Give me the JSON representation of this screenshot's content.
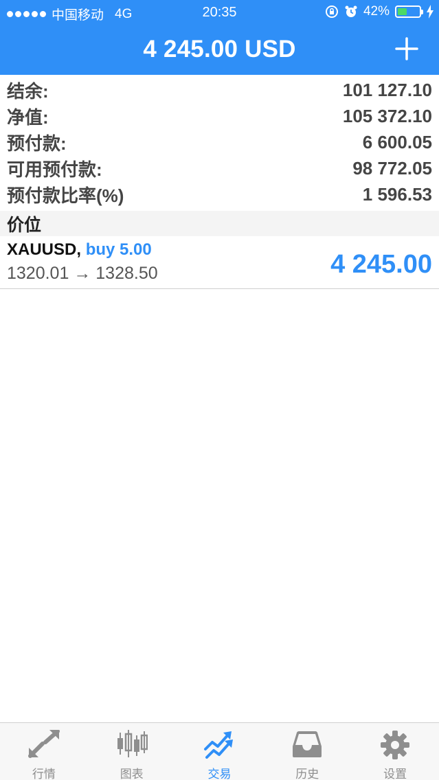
{
  "status_bar": {
    "carrier": "中国移动",
    "network": "4G",
    "time": "20:35",
    "battery_percent": "42%",
    "battery_level": 0.42
  },
  "header": {
    "title": "4 245.00 USD"
  },
  "summary": {
    "rows": [
      {
        "label": "结余:",
        "value": "101 127.10"
      },
      {
        "label": "净值:",
        "value": "105 372.10"
      },
      {
        "label": "预付款:",
        "value": "6 600.05"
      },
      {
        "label": "可用预付款:",
        "value": "98 772.05"
      },
      {
        "label": "预付款比率(%)",
        "value": "1 596.53"
      }
    ]
  },
  "section": {
    "title": "价位"
  },
  "position": {
    "symbol": "XAUUSD,",
    "direction": "buy 5.00",
    "prices": "1320.01 → 1328.50",
    "profit": "4 245.00"
  },
  "tabs": [
    {
      "label": "行情",
      "icon": "quotes-icon",
      "active": false
    },
    {
      "label": "图表",
      "icon": "chart-icon",
      "active": false
    },
    {
      "label": "交易",
      "icon": "trade-icon",
      "active": true
    },
    {
      "label": "历史",
      "icon": "history-icon",
      "active": false
    },
    {
      "label": "设置",
      "icon": "settings-icon",
      "active": false
    }
  ],
  "colors": {
    "accent": "#2f8ff7",
    "inactive": "#8e8e8e",
    "battery": "#4cd964"
  }
}
